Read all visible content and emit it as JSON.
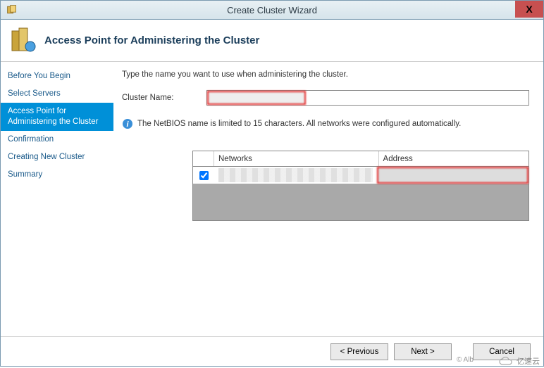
{
  "window": {
    "title": "Create Cluster Wizard",
    "close": "X"
  },
  "header": {
    "title": "Access Point for Administering the Cluster"
  },
  "sidebar": {
    "items": [
      {
        "label": "Before You Begin"
      },
      {
        "label": "Select Servers"
      },
      {
        "label": "Access Point for Administering the Cluster"
      },
      {
        "label": "Confirmation"
      },
      {
        "label": "Creating New Cluster"
      },
      {
        "label": "Summary"
      }
    ],
    "active_index": 2
  },
  "main": {
    "instruction": "Type the name you want to use when administering the cluster.",
    "cluster_name_label": "Cluster Name:",
    "cluster_name_value": "",
    "info_text": "The NetBIOS name is limited to 15 characters.  All networks were configured automatically.",
    "table": {
      "columns": {
        "networks": "Networks",
        "address": "Address"
      },
      "rows": [
        {
          "checked": true,
          "network": "",
          "address": ""
        }
      ]
    }
  },
  "buttons": {
    "previous": "< Previous",
    "next": "Next >",
    "cancel": "Cancel"
  },
  "watermark": {
    "copyright": "© Alb",
    "brand": "亿速云"
  }
}
